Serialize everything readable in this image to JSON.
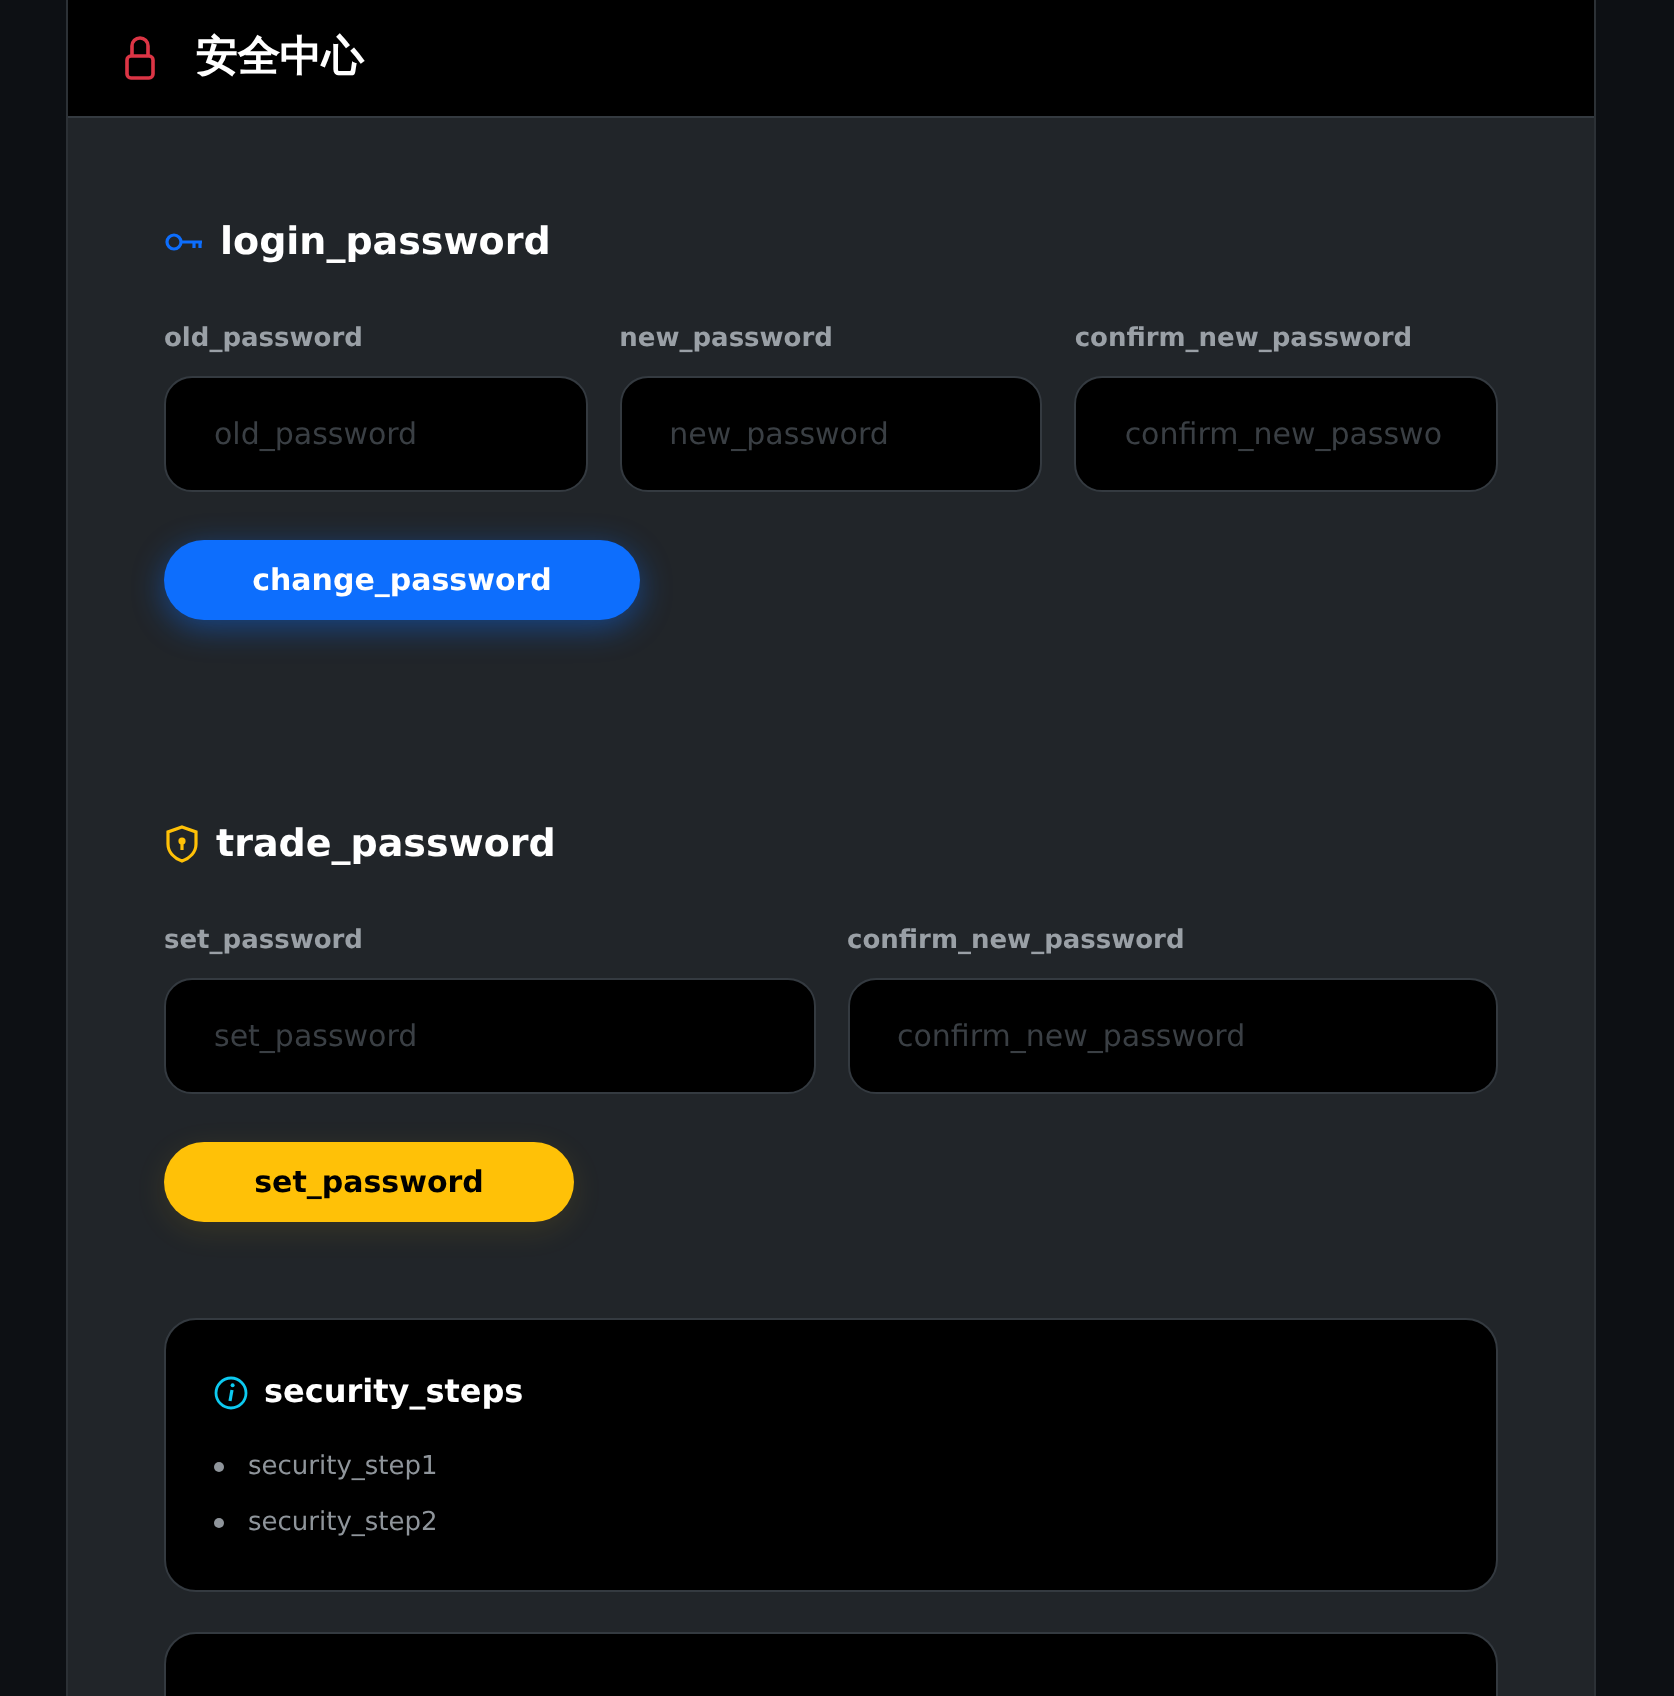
{
  "header": {
    "title": "安全中心"
  },
  "login_password": {
    "title": "login_password",
    "fields": [
      {
        "label": "old_password",
        "placeholder": "old_password"
      },
      {
        "label": "new_password",
        "placeholder": "new_password"
      },
      {
        "label": "confirm_new_password",
        "placeholder": "confirm_new_passwo"
      }
    ],
    "button": "change_password"
  },
  "trade_password": {
    "title": "trade_password",
    "fields": [
      {
        "label": "set_password",
        "placeholder": "set_password"
      },
      {
        "label": "confirm_new_password",
        "placeholder": "confirm_new_password"
      }
    ],
    "button": "set_password"
  },
  "security_steps": {
    "title": "security_steps",
    "items": [
      "security_step1",
      "security_step2"
    ]
  }
}
